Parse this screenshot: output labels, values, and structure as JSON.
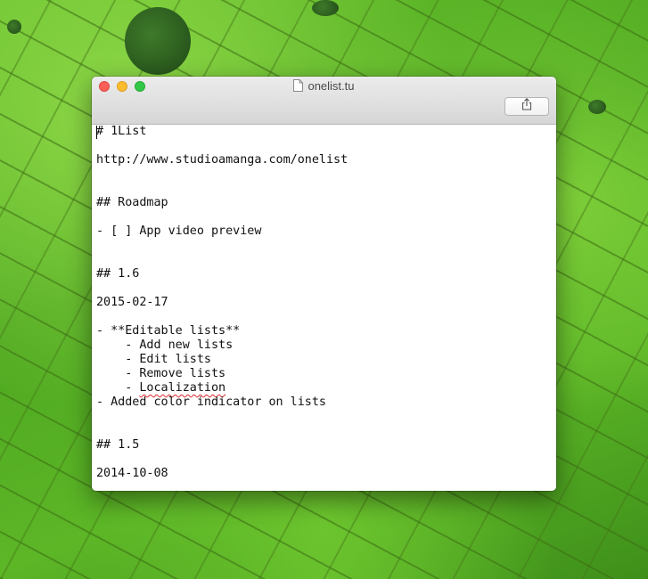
{
  "window": {
    "title": "onelist.tu"
  },
  "editor": {
    "lines": [
      "# 1List",
      "",
      "http://www.studioamanga.com/onelist",
      "",
      "",
      "## Roadmap",
      "",
      "- [ ] App video preview",
      "",
      "",
      "## 1.6",
      "",
      "2015-02-17",
      "",
      "- **Editable lists**",
      "    - Add new lists",
      "    - Edit lists",
      "    - Remove lists",
      "    - ",
      "- Added color indicator on lists",
      "",
      "",
      "## 1.5",
      "",
      "2014-10-08"
    ],
    "misspelled_word": "Localization"
  },
  "colors": {
    "close": "#fc5f57",
    "minimize": "#fdbc2e",
    "zoom": "#33c748",
    "spellcheck_underline": "#e0262c"
  },
  "icons": {
    "title_icon": "document-icon",
    "share_icon": "share-icon"
  }
}
